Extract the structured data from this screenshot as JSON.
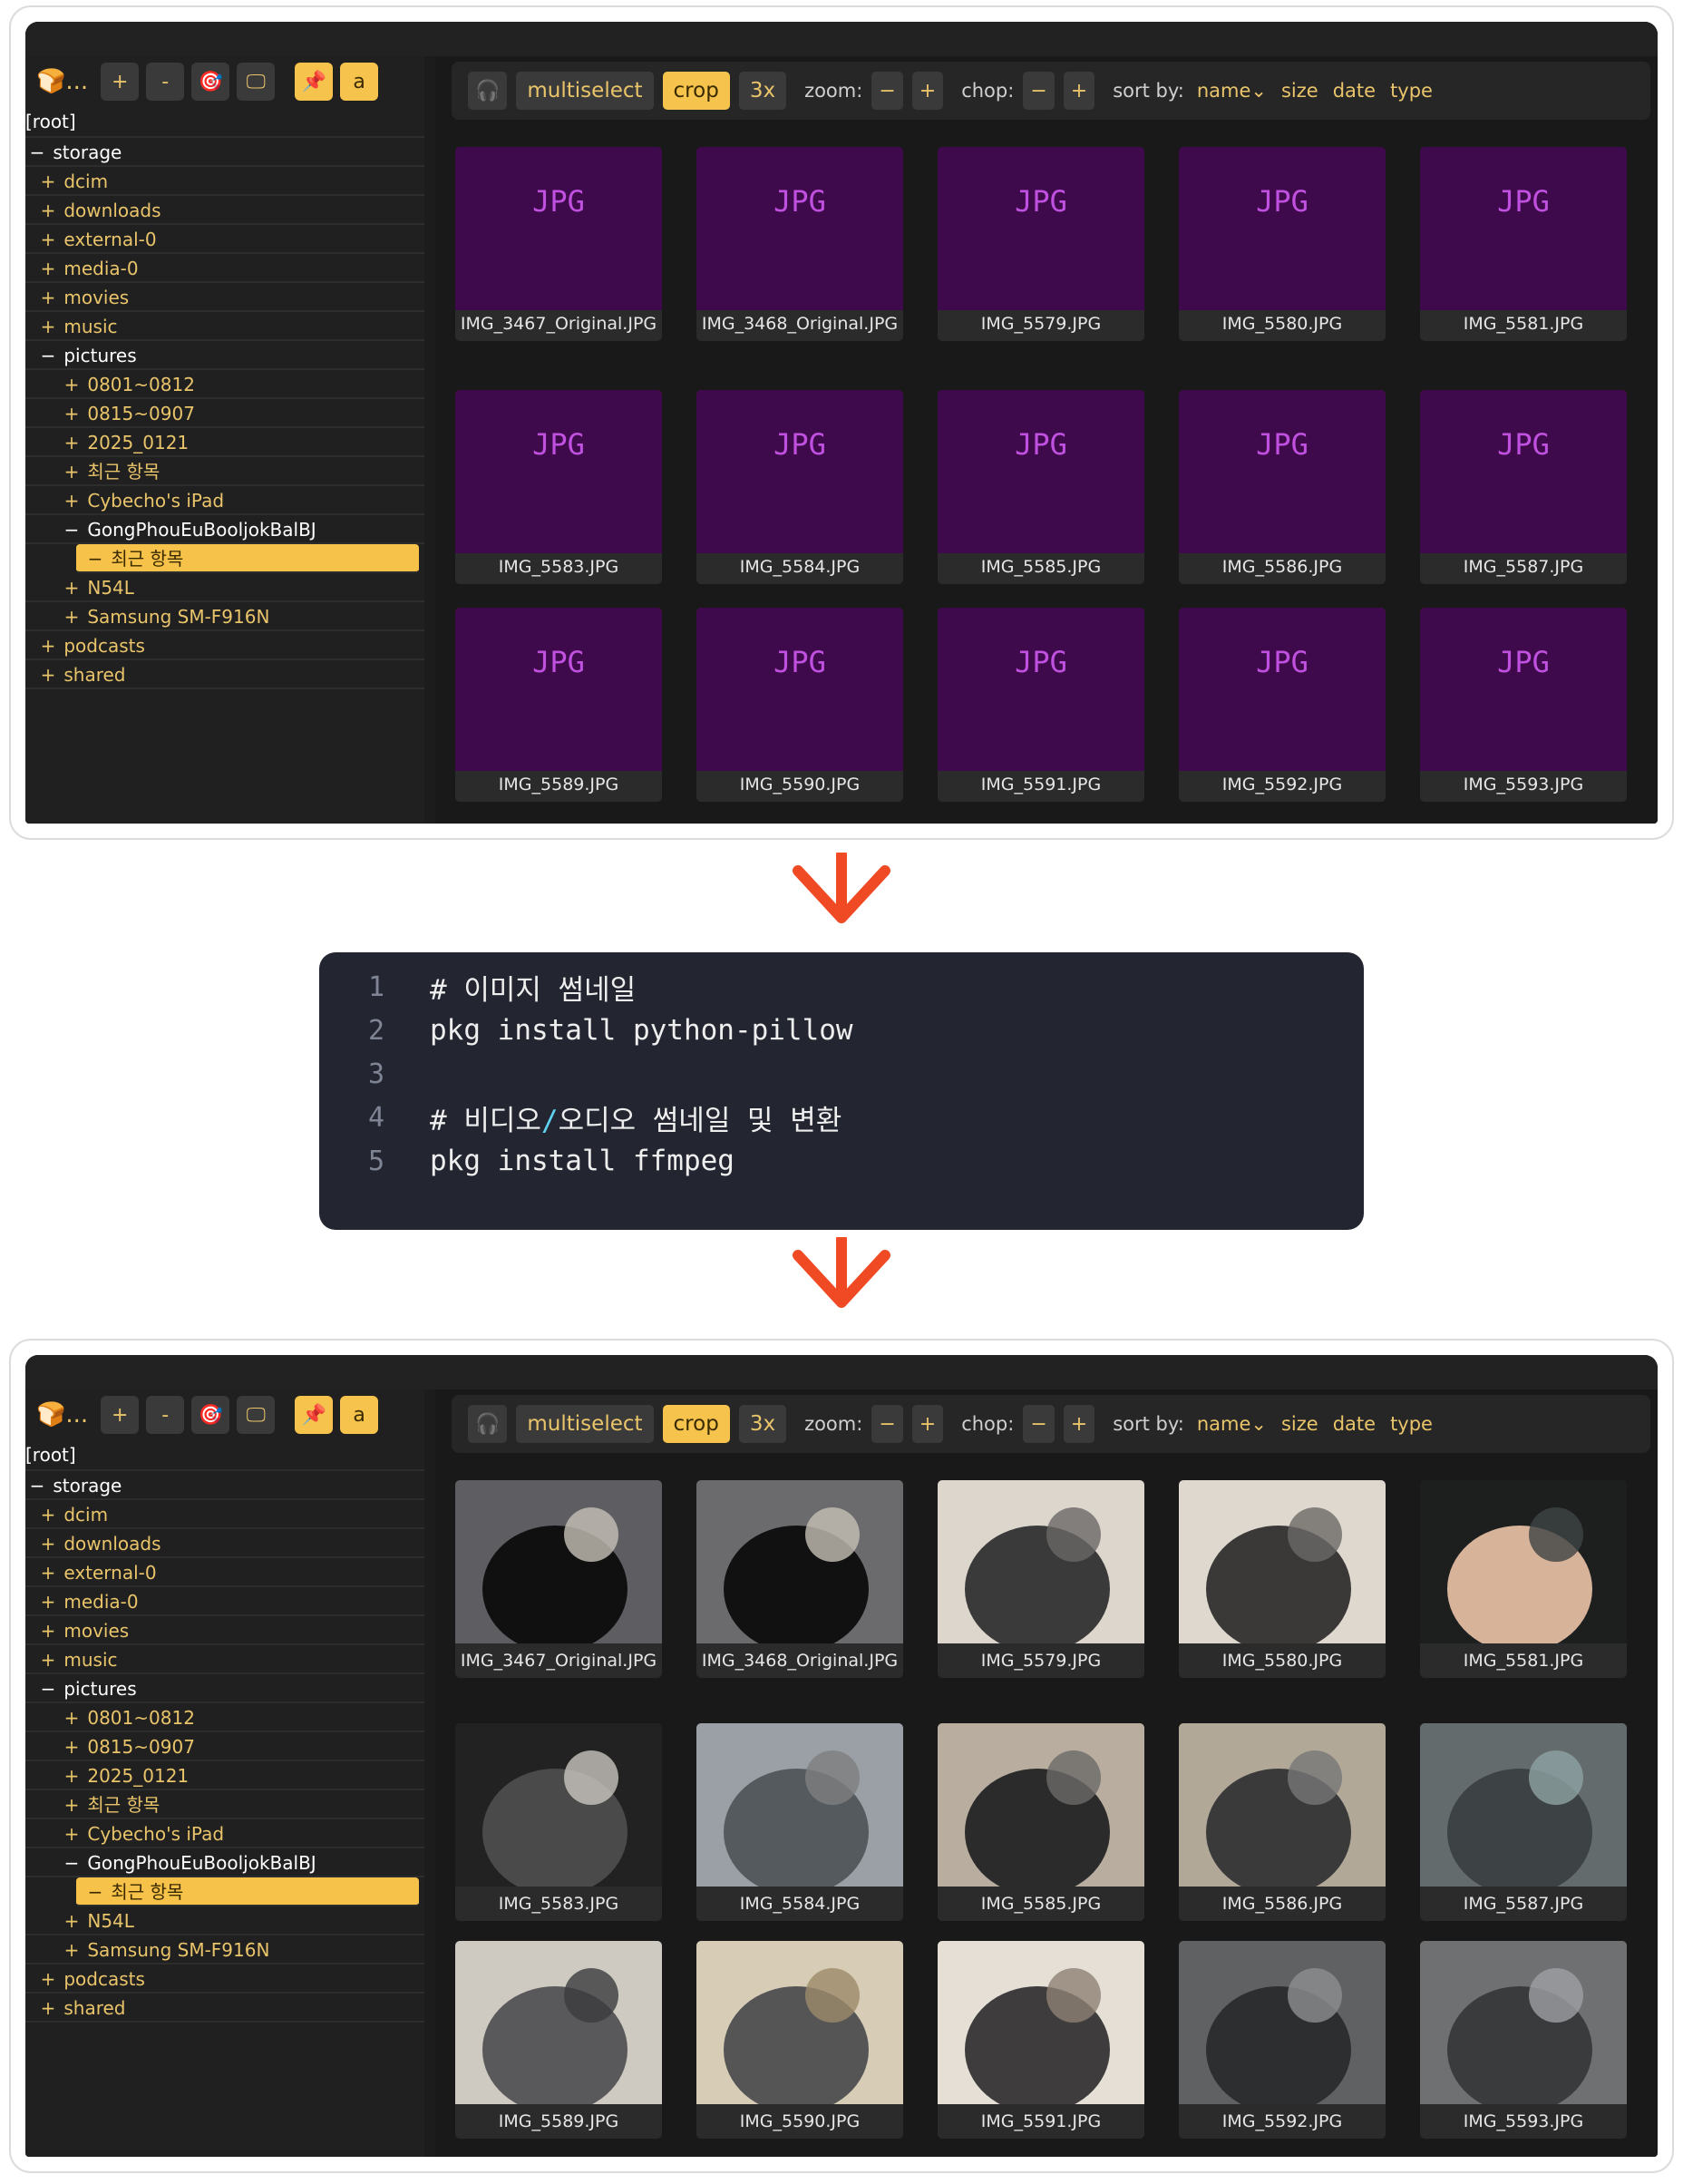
{
  "sidebar": {
    "toolbar": {
      "b0": "🍞...",
      "b1": "+",
      "b2": "-",
      "b3": "🎯",
      "b4": "🖵",
      "b5": "📌",
      "b6": "a"
    },
    "root": "[root]",
    "items": [
      {
        "sign": "−",
        "label": "storage"
      },
      {
        "sign": "+",
        "label": "dcim"
      },
      {
        "sign": "+",
        "label": "downloads"
      },
      {
        "sign": "+",
        "label": "external-0"
      },
      {
        "sign": "+",
        "label": "media-0"
      },
      {
        "sign": "+",
        "label": "movies"
      },
      {
        "sign": "+",
        "label": "music"
      },
      {
        "sign": "−",
        "label": "pictures"
      },
      {
        "sign": "+",
        "label": "0801~0812"
      },
      {
        "sign": "+",
        "label": "0815~0907"
      },
      {
        "sign": "+",
        "label": "2025_0121"
      },
      {
        "sign": "+",
        "label": "최근 항목"
      },
      {
        "sign": "+",
        "label": "Cybecho's iPad"
      },
      {
        "sign": "−",
        "label": "GongPhouEuBooljokBalBJ"
      },
      {
        "sign": "−",
        "label": "최근 항목"
      },
      {
        "sign": "+",
        "label": "N54L"
      },
      {
        "sign": "+",
        "label": "Samsung SM-F916N"
      },
      {
        "sign": "+",
        "label": "podcasts"
      },
      {
        "sign": "+",
        "label": "shared"
      }
    ]
  },
  "topbar": {
    "headphones": "🎧",
    "multiselect": "multiselect",
    "crop": "crop",
    "three_x": "3x",
    "zoom_label": "zoom:",
    "zoom_minus": "−",
    "zoom_plus": "+",
    "chop_label": "chop:",
    "chop_minus": "−",
    "chop_plus": "+",
    "sort_label": "sort by:",
    "sort_name": "name⌄",
    "sort_size": "size",
    "sort_date": "date",
    "sort_type": "type"
  },
  "placeholder_text": "JPG",
  "files": [
    "IMG_3467_Original.JPG",
    "IMG_3468_Original.JPG",
    "IMG_5579.JPG",
    "IMG_5580.JPG",
    "IMG_5581.JPG",
    "IMG_5583.JPG",
    "IMG_5584.JPG",
    "IMG_5585.JPG",
    "IMG_5586.JPG",
    "IMG_5587.JPG",
    "IMG_5589.JPG",
    "IMG_5590.JPG",
    "IMG_5591.JPG",
    "IMG_5592.JPG",
    "IMG_5593.JPG"
  ],
  "code": {
    "lines": [
      {
        "n": "1",
        "text": "# 이미지 썸네일"
      },
      {
        "n": "2",
        "text": "pkg install python-pillow"
      },
      {
        "n": "3",
        "text": ""
      },
      {
        "n": "4",
        "pre": "# 비디오",
        "slash": "/",
        "post": "오디오 썸네일 및 변환"
      },
      {
        "n": "5",
        "text": "pkg install ffmpeg"
      }
    ]
  },
  "colors": {
    "accent": "#f6c34d",
    "arrow": "#f04a24",
    "placeholder_bg": "#3f0a4b",
    "placeholder_text": "#c050e0"
  }
}
